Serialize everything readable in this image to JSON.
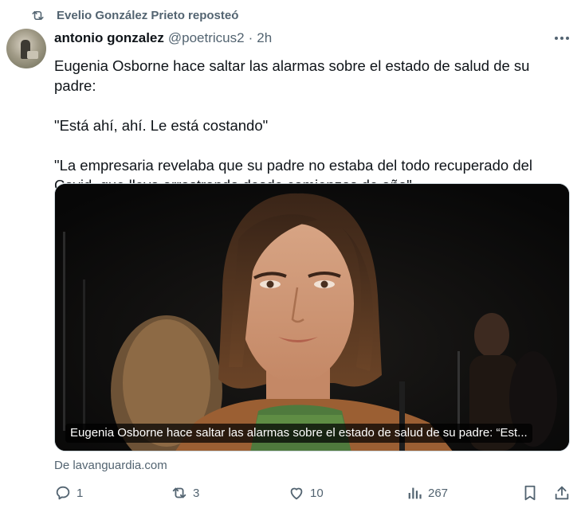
{
  "repost": {
    "text": "Evelio González Prieto reposteó",
    "icon": "repost-icon"
  },
  "author": {
    "name": "antonio gonzalez",
    "handle": "@poetricus2",
    "separator": "·",
    "time": "2h"
  },
  "tweet": {
    "paragraphs": [
      "Eugenia Osborne hace saltar las alarmas sobre el estado de salud de su padre:",
      "\"Está ahí, ahí. Le está costando\"",
      "\"La empresaria revelaba que su padre no estaba del todo recuperado del Covid, que lleva arrastrando desde comienzos de año\"."
    ]
  },
  "card": {
    "caption": "Eugenia Osborne hace saltar las alarmas sobre el estado de salud de su padre: “Est...",
    "source": "De lavanguardia.com"
  },
  "actions": {
    "reply_count": "1",
    "repost_count": "3",
    "like_count": "10",
    "views_count": "267"
  },
  "colors": {
    "text_primary": "#0f1419",
    "text_secondary": "#536471",
    "border": "#cfd9de"
  }
}
